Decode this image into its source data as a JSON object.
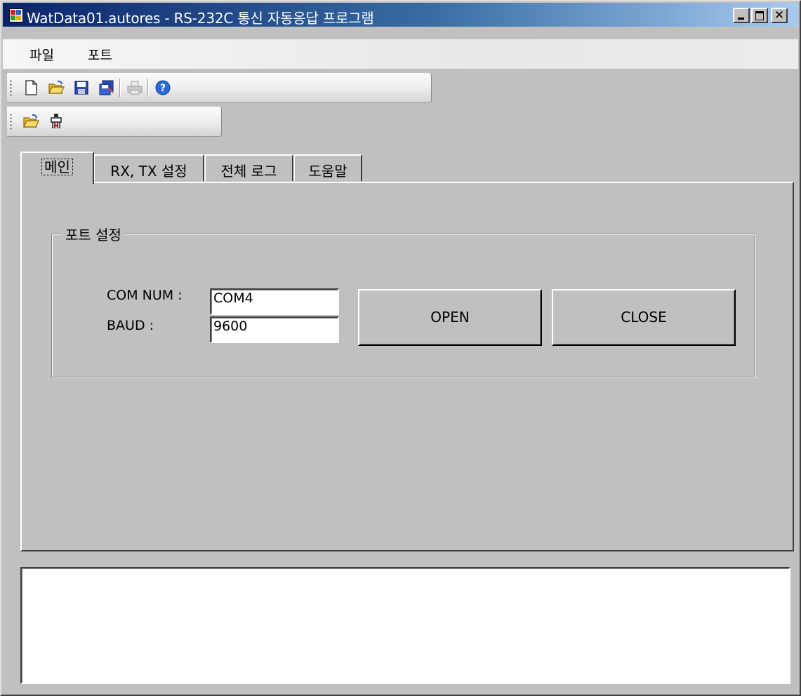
{
  "window": {
    "title": "WatData01.autores - RS-232C 통신 자동응답 프로그램",
    "title_gradient": [
      "#0a246a",
      "#a6caf0"
    ]
  },
  "menu": {
    "items": [
      {
        "label": "파일"
      },
      {
        "label": "포트"
      }
    ]
  },
  "toolbar1": {
    "buttons": [
      {
        "icon": "new-document-icon"
      },
      {
        "icon": "open-folder-icon"
      },
      {
        "icon": "save-icon"
      },
      {
        "icon": "save-all-icon"
      },
      {
        "icon": "print-icon",
        "enabled": false
      },
      {
        "icon": "help-icon"
      }
    ]
  },
  "toolbar2": {
    "buttons": [
      {
        "icon": "open-folder-icon"
      },
      {
        "icon": "serial-connector-icon"
      }
    ]
  },
  "tabs": [
    {
      "label": "메인",
      "active": true
    },
    {
      "label": "RX, TX 설정",
      "active": false
    },
    {
      "label": "전체 로그",
      "active": false
    },
    {
      "label": "도움말",
      "active": false
    }
  ],
  "port_settings": {
    "group_title": "포트 설정",
    "com_label": "COM NUM :",
    "com_value": "COM4",
    "baud_label": "BAUD :",
    "baud_value": "9600",
    "open_label": "OPEN",
    "close_label": "CLOSE"
  },
  "output": {
    "text": ""
  }
}
